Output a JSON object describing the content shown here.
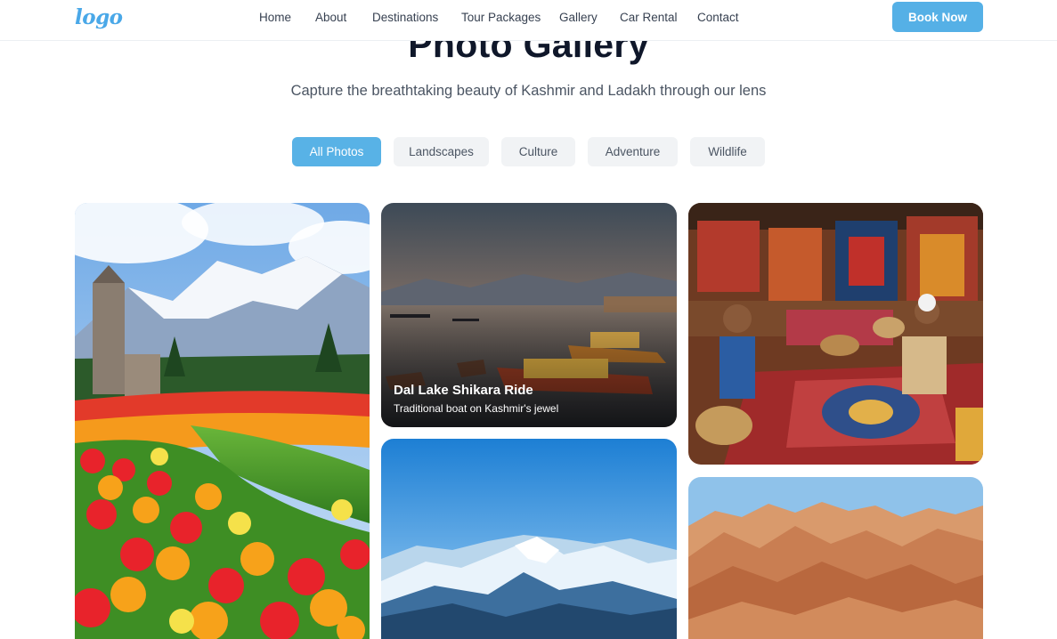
{
  "nav": {
    "logo": "logo",
    "links": [
      "Home",
      "About",
      "Destinations",
      "Tour Packages",
      "Gallery",
      "Car Rental",
      "Contact"
    ],
    "cta": "Book Now"
  },
  "header": {
    "title": "Photo Gallery",
    "subtitle": "Capture the breathtaking beauty of Kashmir and Ladakh through our lens"
  },
  "filters": {
    "items": [
      "All Photos",
      "Landscapes",
      "Culture",
      "Adventure",
      "Wildlife"
    ],
    "active": "All Photos"
  },
  "gallery": {
    "featured": {
      "title": "Dal Lake Shikara Ride",
      "subtitle": "Traditional boat on Kashmir's jewel"
    }
  },
  "colors": {
    "accent": "#55b0e6",
    "filter_bg": "#f1f3f5",
    "title": "#0f172a"
  }
}
